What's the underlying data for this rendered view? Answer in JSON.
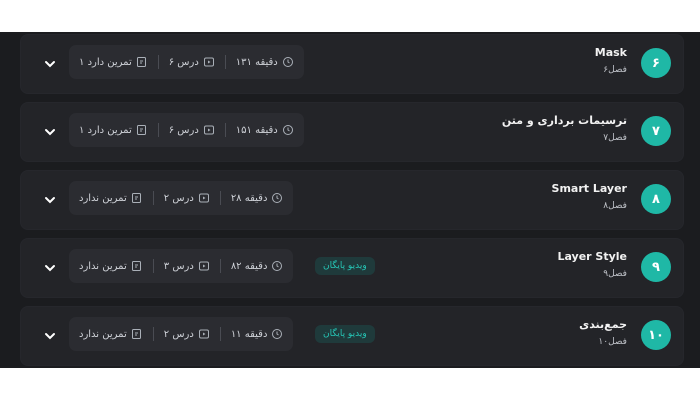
{
  "colors": {
    "accent": "#1fb8a6",
    "row_bg": "#232428",
    "panel_bg": "#1b1c1f"
  },
  "chapters": [
    {
      "num": "۶",
      "title": "Mask",
      "subtitle": "فصل۶",
      "duration": "۱۳۱ دقیقه",
      "lessons": "۶ درس",
      "exercises": "۱ تمرین دارد"
    },
    {
      "num": "۷",
      "title": "ترسیمات برداری و متن",
      "subtitle": "فصل۷",
      "duration": "۱۵۱ دقیقه",
      "lessons": "۶ درس",
      "exercises": "۱ تمرین دارد"
    },
    {
      "num": "۸",
      "title": "Smart Layer",
      "subtitle": "فصل۸",
      "duration": "۲۸ دقیقه",
      "lessons": "۲ درس",
      "exercises": "تمرین ندارد"
    },
    {
      "num": "۹",
      "title": "Layer Style",
      "subtitle": "فصل۹",
      "duration": "۸۲ دقیقه",
      "lessons": "۳ درس",
      "exercises": "تمرین ندارد",
      "badge": "ویدیو پایگان"
    },
    {
      "num": "۱۰",
      "title": "جمع‌بندی",
      "subtitle": "فصل۱۰",
      "duration": "۱۱ دقیقه",
      "lessons": "۲ درس",
      "exercises": "تمرین ندارد",
      "badge": "ویدیو پایگان"
    }
  ]
}
